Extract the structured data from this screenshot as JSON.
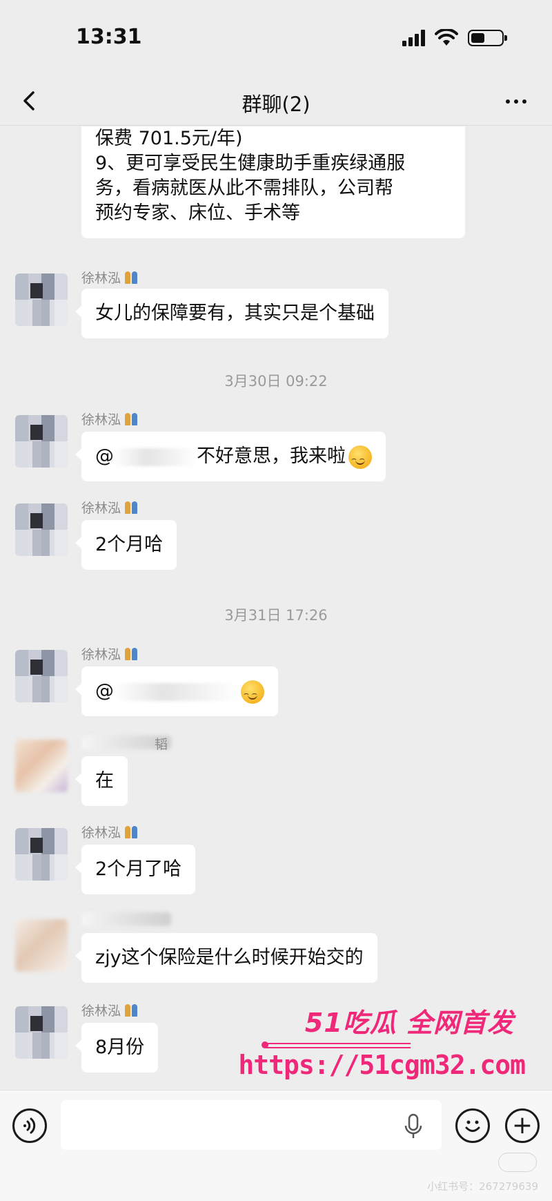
{
  "status_bar": {
    "time": "13:31"
  },
  "nav": {
    "title": "群聊(2)"
  },
  "messages": [
    {
      "lines": [
        "保费 701.5元/年)",
        "9、更可享受民生健康助手重疾绿通服",
        "务，看病就医从此不需排队，公司帮",
        "预约专家、床位、手术等"
      ]
    },
    {
      "sender": "徐林泓",
      "text": "女儿的保障要有，其实只是个基础"
    },
    {
      "sender": "徐林泓",
      "text": "不好意思，我来啦",
      "prefix": "@"
    },
    {
      "sender": "徐林泓",
      "text": "2个月哈"
    },
    {
      "sender": "徐林泓",
      "text": "",
      "prefix": "@"
    },
    {
      "sender_partial": "韬",
      "text": "在"
    },
    {
      "sender": "徐林泓",
      "text": "2个月了哈"
    },
    {
      "text": "zjy这个保险是什么时候开始交的"
    },
    {
      "sender": "徐林泓",
      "text": "8月份"
    }
  ],
  "timestamps": [
    "3月30日 09:22",
    "3月31日 17:26"
  ],
  "watermark": {
    "brand": "51吃瓜 全网首发",
    "url": "https://51cgm32.com",
    "small": "小红书号：267279639"
  },
  "colors": {
    "background": "#ededed",
    "bubble": "#ffffff",
    "watermark": "#f0287a"
  },
  "icons": [
    "back-icon",
    "more-icon",
    "voice-icon",
    "mic-icon",
    "emoji-icon",
    "plus-icon",
    "people-icon"
  ]
}
